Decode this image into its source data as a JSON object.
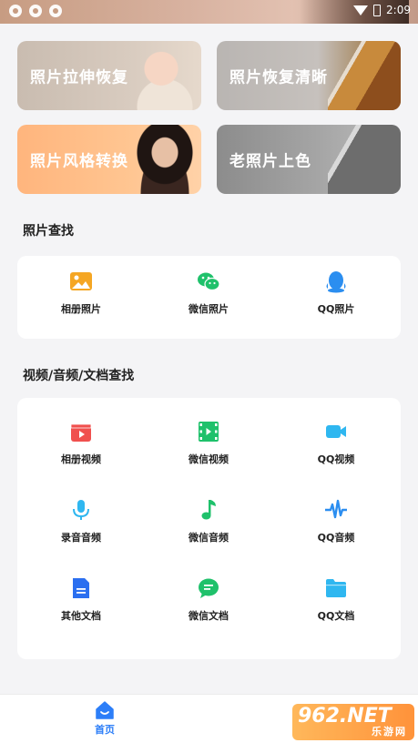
{
  "status_bar": {
    "time": "2:09"
  },
  "cards": [
    {
      "label": "照片拉伸恢复",
      "art": "baby-photo"
    },
    {
      "label": "照片恢复清晰",
      "art": "autumn-tree-photo"
    },
    {
      "label": "照片风格转换",
      "art": "woman-portrait"
    },
    {
      "label": "老照片上色",
      "art": "vintage-portrait"
    }
  ],
  "photo_section": {
    "title": "照片查找",
    "items": [
      {
        "label": "相册照片",
        "icon": "image-icon",
        "color": "#f5a623"
      },
      {
        "label": "微信照片",
        "icon": "wechat-icon",
        "color": "#1fc16b"
      },
      {
        "label": "QQ照片",
        "icon": "qq-penguin-icon",
        "color": "#2b8ef0"
      }
    ]
  },
  "media_section": {
    "title": "视频/音频/文档查找",
    "items": [
      {
        "label": "相册视频",
        "icon": "video-clapper-icon",
        "color": "#f0504e"
      },
      {
        "label": "微信视频",
        "icon": "film-icon",
        "color": "#1fc16b"
      },
      {
        "label": "QQ视频",
        "icon": "camcorder-icon",
        "color": "#2fb7f0"
      },
      {
        "label": "录音音频",
        "icon": "microphone-icon",
        "color": "#2fb7f0"
      },
      {
        "label": "微信音频",
        "icon": "music-note-icon",
        "color": "#1fc16b"
      },
      {
        "label": "QQ音频",
        "icon": "waveform-icon",
        "color": "#2b8ef0"
      },
      {
        "label": "其他文档",
        "icon": "document-icon",
        "color": "#2b6ff0"
      },
      {
        "label": "微信文档",
        "icon": "chat-bubble-icon",
        "color": "#1fc16b"
      },
      {
        "label": "QQ文档",
        "icon": "folder-icon",
        "color": "#2fb7f0"
      }
    ]
  },
  "bottom_nav": {
    "home_label": "首页",
    "accent": "#2c7ef8"
  },
  "watermark": {
    "top": "962.NET",
    "bottom": "乐游网"
  }
}
